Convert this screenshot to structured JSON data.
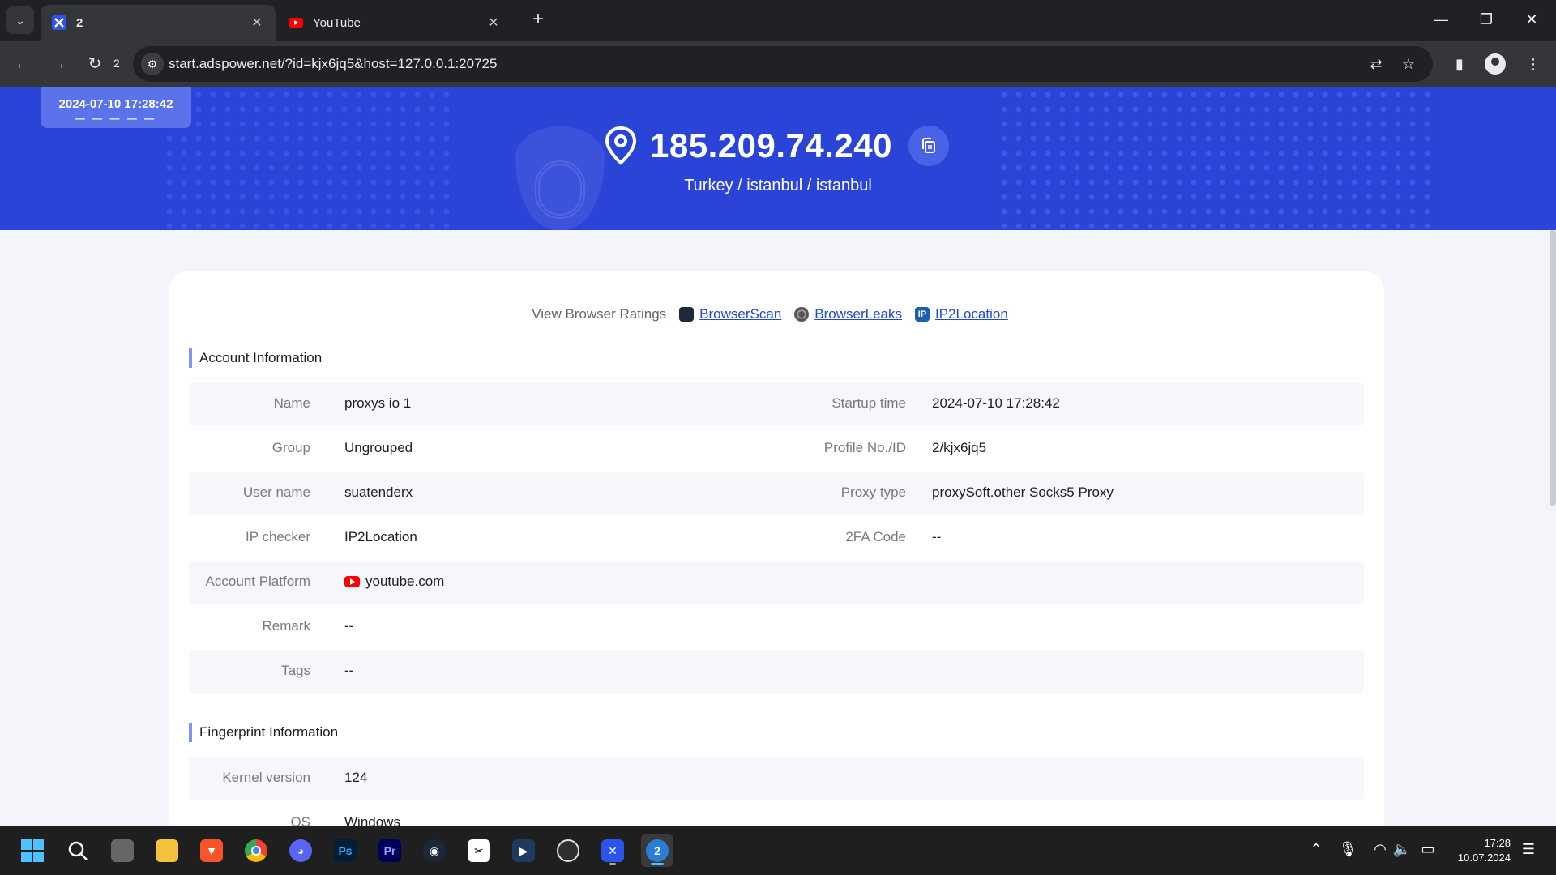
{
  "browser": {
    "tabs": [
      {
        "title": "2",
        "active": true
      },
      {
        "title": "YouTube",
        "active": false
      }
    ],
    "reload_count": "2",
    "url": "start.adspower.net/?id=kjx6jq5&host=127.0.0.1:20725"
  },
  "hero": {
    "date": "2024-07-10 17:28:42",
    "dashes": "— — — — —",
    "ip": "185.209.74.240",
    "location": "Turkey / istanbul / istanbul"
  },
  "ratings": {
    "label": "View Browser Ratings",
    "links": [
      "BrowserScan",
      "BrowserLeaks",
      "IP2Location"
    ]
  },
  "account": {
    "title": "Account Information",
    "rows": [
      {
        "k1": "Name",
        "v1": "proxys io 1",
        "k2": "Startup time",
        "v2": "2024-07-10 17:28:42"
      },
      {
        "k1": "Group",
        "v1": "Ungrouped",
        "k2": "Profile No./ID",
        "v2": "2/kjx6jq5"
      },
      {
        "k1": "User name",
        "v1": "suatenderx",
        "k2": "Proxy type",
        "v2": "proxySoft.other Socks5 Proxy"
      },
      {
        "k1": "IP checker",
        "v1": "IP2Location",
        "k2": "2FA Code",
        "v2": "--"
      },
      {
        "k1": "Account Platform",
        "v1": "youtube.com"
      },
      {
        "k1": "Remark",
        "v1": "--"
      },
      {
        "k1": "Tags",
        "v1": "--"
      }
    ]
  },
  "fingerprint": {
    "title": "Fingerprint Information",
    "rows": [
      {
        "k1": "Kernel version",
        "v1": "124"
      },
      {
        "k1": "OS",
        "v1": "Windows"
      }
    ]
  },
  "taskbar": {
    "apps": [
      "start",
      "search",
      "task-view",
      "file-explorer",
      "brave",
      "chrome",
      "discord",
      "photoshop",
      "premiere",
      "steam",
      "capcut",
      "app-cube",
      "obs",
      "adspower",
      "browser-profile"
    ],
    "time": "17:28",
    "date": "10.07.2024"
  },
  "colors": {
    "hero": "#2b44d8",
    "link": "#1f49d0",
    "accent": "#7d93f5"
  }
}
